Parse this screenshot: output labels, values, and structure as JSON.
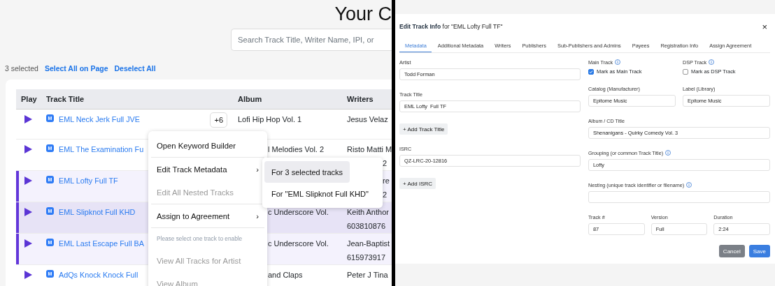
{
  "library": {
    "title": "Your C",
    "search": {
      "placeholder": "Search Track Title, Writer Name, IPI, or"
    },
    "selection": {
      "count": "3 selected",
      "actions": [
        "Select All on Page",
        "Deselect All"
      ]
    },
    "table": {
      "columns": [
        "Play",
        "Track Title",
        "Album",
        "Writers"
      ],
      "rows": [
        {
          "tag": "M",
          "title": "EML Neck Jerk Full JVE",
          "extra": "+6",
          "album": "Lofi Hip Hop Vol. 1",
          "writers": [
            "Jesus Velaz"
          ],
          "selected": false,
          "active": false
        },
        {
          "tag": "M",
          "title": "EML The Examination Fu",
          "album": "l Melodies Vol. 2",
          "writers": [
            "Risto Matti M",
            "2"
          ],
          "selected": false,
          "active": false
        },
        {
          "tag": "M",
          "title": "EML Lofty Full TF",
          "writers": [
            "re",
            "2"
          ],
          "selected": true,
          "active": false
        },
        {
          "tag": "M",
          "title": "EML Slipknot Full KHD",
          "album": "c Underscore Vol.",
          "writers": [
            "Keith Anthor",
            "603810876"
          ],
          "selected": true,
          "active": true
        },
        {
          "tag": "M",
          "title": "EML Last Escape Full BA",
          "album": "c Underscore Vol.",
          "writers": [
            "Jean-Baptist",
            "615973917"
          ],
          "selected": true,
          "active": false
        },
        {
          "tag": "M",
          "title": "AdQs Knock Knock Full",
          "album": "and Claps",
          "writers": [
            "Peter J Tina"
          ],
          "selected": false,
          "active": false
        }
      ]
    },
    "context_menu": {
      "items": [
        {
          "kind": "item",
          "label": "Open Keyword Builder",
          "disabled": false
        },
        {
          "kind": "divider"
        },
        {
          "kind": "item",
          "label": "Edit Track Metadata",
          "arrow": "›",
          "disabled": false
        },
        {
          "kind": "item",
          "label": "Edit All Nested Tracks",
          "disabled": true
        },
        {
          "kind": "divider"
        },
        {
          "kind": "item",
          "label": "Assign to Agreement",
          "arrow": "›",
          "disabled": false
        },
        {
          "kind": "divider"
        },
        {
          "kind": "note",
          "label": "Please select one track to enable"
        },
        {
          "kind": "item",
          "label": "View All Tracks for Artist",
          "disabled": true
        },
        {
          "kind": "item",
          "label": "View Album",
          "disabled": true
        }
      ],
      "submenu": [
        {
          "label": "For 3 selected tracks",
          "selected": true
        },
        {
          "label": "For \"EML Slipknot Full KHD\"",
          "selected": false
        }
      ]
    }
  },
  "editor": {
    "title": "**Edit Track Info** for \"EML Lofty Full TF\"",
    "close": "×",
    "tabs": [
      {
        "label": "Metadata",
        "selected": true
      },
      {
        "label": "Additional Metadata",
        "selected": false
      },
      {
        "label": "Writers",
        "selected": false
      },
      {
        "label": "Publishers",
        "selected": false
      },
      {
        "label": "Sub-Publishers and Admins",
        "selected": false
      },
      {
        "label": "Payees",
        "selected": false
      },
      {
        "label": "Registration Info",
        "selected": false
      },
      {
        "label": "Assign Agreement",
        "selected": false
      }
    ],
    "left_column": [
      {
        "kind": "field",
        "label": "Artist",
        "value": "Todd Forman"
      },
      {
        "kind": "field",
        "label": "Track Title",
        "value": "EML Lofty  Full TF"
      },
      {
        "kind": "button",
        "label": "+ Add Track Title"
      },
      {
        "kind": "field",
        "label": "ISRC",
        "value": "QZ-LRC-20-12816"
      },
      {
        "kind": "button",
        "label": "+ Add ISRC"
      }
    ],
    "right_rows": [
      [
        {
          "kind": "checkbox",
          "label": "Main Track",
          "info": true,
          "option": "Mark as Main Track",
          "checked": true
        },
        {
          "kind": "checkbox",
          "label": "DSP Track",
          "info": true,
          "option": "Mark as DSP Track",
          "checked": false
        }
      ],
      [
        {
          "kind": "field",
          "label": "Catalog (Manufacturer)",
          "info": false,
          "value": "Epitome Music"
        },
        {
          "kind": "field",
          "label": "Label (Library)",
          "info": false,
          "value": "Epitome Music"
        }
      ],
      [
        {
          "kind": "field",
          "label": "Album / CD Title",
          "info": false,
          "value": "Shenanigans - Quirky Comedy Vol. 3"
        }
      ],
      [
        {
          "kind": "field",
          "label": "Grouping (or common Track Title)",
          "info": true,
          "value": "Lofty"
        }
      ],
      [
        {
          "kind": "field",
          "label": "Nesting (unique track identifier or filename)",
          "info": true
        }
      ],
      [
        {
          "kind": "field",
          "label": "Track #",
          "info": false,
          "value": "87"
        },
        {
          "kind": "field",
          "label": "Version",
          "info": false,
          "value": "Full"
        },
        {
          "kind": "field",
          "label": "Duration",
          "info": false,
          "value": "2:24"
        }
      ]
    ],
    "buttons": [
      {
        "kind": "secondary",
        "label": "Cancel"
      },
      {
        "kind": "primary",
        "label": "Save"
      }
    ]
  }
}
